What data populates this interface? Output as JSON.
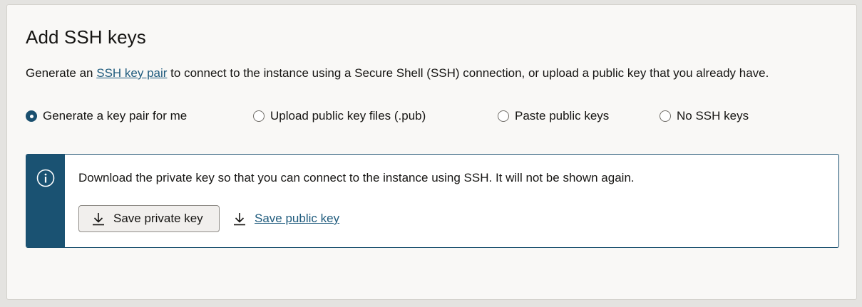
{
  "section": {
    "title": "Add SSH keys",
    "description_prefix": "Generate an ",
    "description_link": "SSH key pair",
    "description_suffix": " to connect to the instance using a Secure Shell (SSH) connection, or upload a public key that you already have."
  },
  "key_options": {
    "selected": "Generate a key pair for me",
    "items": [
      {
        "label": "Generate a key pair for me",
        "checked": true
      },
      {
        "label": "Upload public key files (.pub)",
        "checked": false
      },
      {
        "label": "Paste public keys",
        "checked": false
      },
      {
        "label": "No SSH keys",
        "checked": false
      }
    ]
  },
  "info_box": {
    "icon": "info-icon",
    "message": "Download the private key so that you can connect to the instance using SSH. It will not be shown again.",
    "save_private_label": "Save private key",
    "save_public_label": "Save public key",
    "download_icon": "download-icon"
  },
  "colors": {
    "accent": "#1a4f6e",
    "link": "#1f5b7d",
    "panel_bg": "#f9f8f6",
    "page_bg": "#e4e3e0"
  }
}
